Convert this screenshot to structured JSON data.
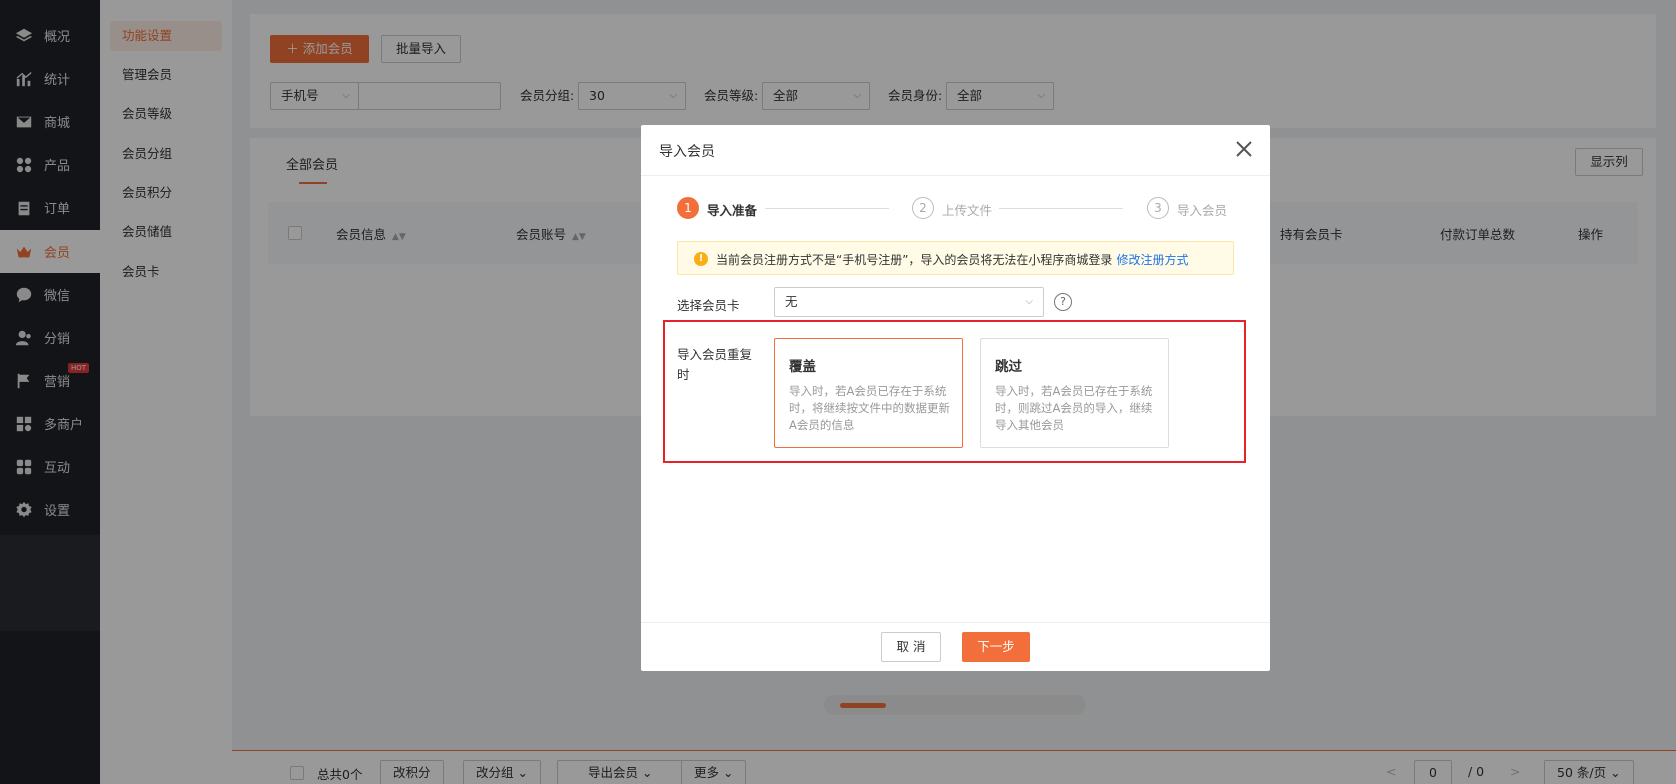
{
  "nav": {
    "items": [
      {
        "label": "概况",
        "icon": "layers-icon"
      },
      {
        "label": "统计",
        "icon": "chart-icon"
      },
      {
        "label": "商城",
        "icon": "mail-icon"
      },
      {
        "label": "产品",
        "icon": "grid-icon"
      },
      {
        "label": "订单",
        "icon": "clipboard-icon"
      },
      {
        "label": "会员",
        "icon": "crown-icon"
      },
      {
        "label": "微信",
        "icon": "chat-icon"
      },
      {
        "label": "分销",
        "icon": "people-icon"
      },
      {
        "label": "营销",
        "icon": "flag-icon"
      },
      {
        "label": "多商户",
        "icon": "store-icon"
      },
      {
        "label": "互动",
        "icon": "blocks-icon"
      },
      {
        "label": "设置",
        "icon": "gear-icon"
      }
    ],
    "hot_badge": "HOT",
    "active_color": "#f26e3a"
  },
  "subnav": {
    "items": [
      "功能设置",
      "管理会员",
      "会员等级",
      "会员分组",
      "会员积分",
      "会员储值",
      "会员卡"
    ]
  },
  "toolbar": {
    "add_label": "添加会员",
    "add_icon": "plus-icon",
    "import_label": "批量导入"
  },
  "filters": {
    "search_type": "手机号",
    "search_value": "",
    "group_label": "会员分组:",
    "group_value": "30",
    "level_label": "会员等级:",
    "level_value": "全部",
    "identity_label": "会员身份:",
    "identity_value": "全部"
  },
  "table": {
    "tab": "全部会员",
    "show_columns": "显示列",
    "headers": {
      "info": "会员信息",
      "account": "会员账号",
      "card": "持有会员卡",
      "orders": "付款订单总数",
      "action": "操作"
    }
  },
  "footer": {
    "total": "总共0个",
    "points": "改积分",
    "group": "改分组",
    "export": "导出会员",
    "more": "更多",
    "page": "0",
    "page_total": "/ 0",
    "page_size": "50 条/页"
  },
  "modal": {
    "title": "导入会员",
    "steps": [
      {
        "num": "1",
        "label": "导入准备"
      },
      {
        "num": "2",
        "label": "上传文件"
      },
      {
        "num": "3",
        "label": "导入会员"
      }
    ],
    "notice": "当前会员注册方式不是“手机号注册”，导入的会员将无法在小程序商城登录",
    "notice_link": "修改注册方式",
    "card_label": "选择会员卡",
    "card_value": "无",
    "dup_label": "导入会员重复时",
    "options": [
      {
        "title": "覆盖",
        "desc": "导入时，若A会员已存在于系统时，将继续按文件中的数据更新A会员的信息"
      },
      {
        "title": "跳过",
        "desc": "导入时，若A会员已存在于系统时，则跳过A会员的导入，继续导入其他会员"
      }
    ],
    "cancel": "取 消",
    "next": "下一步"
  }
}
